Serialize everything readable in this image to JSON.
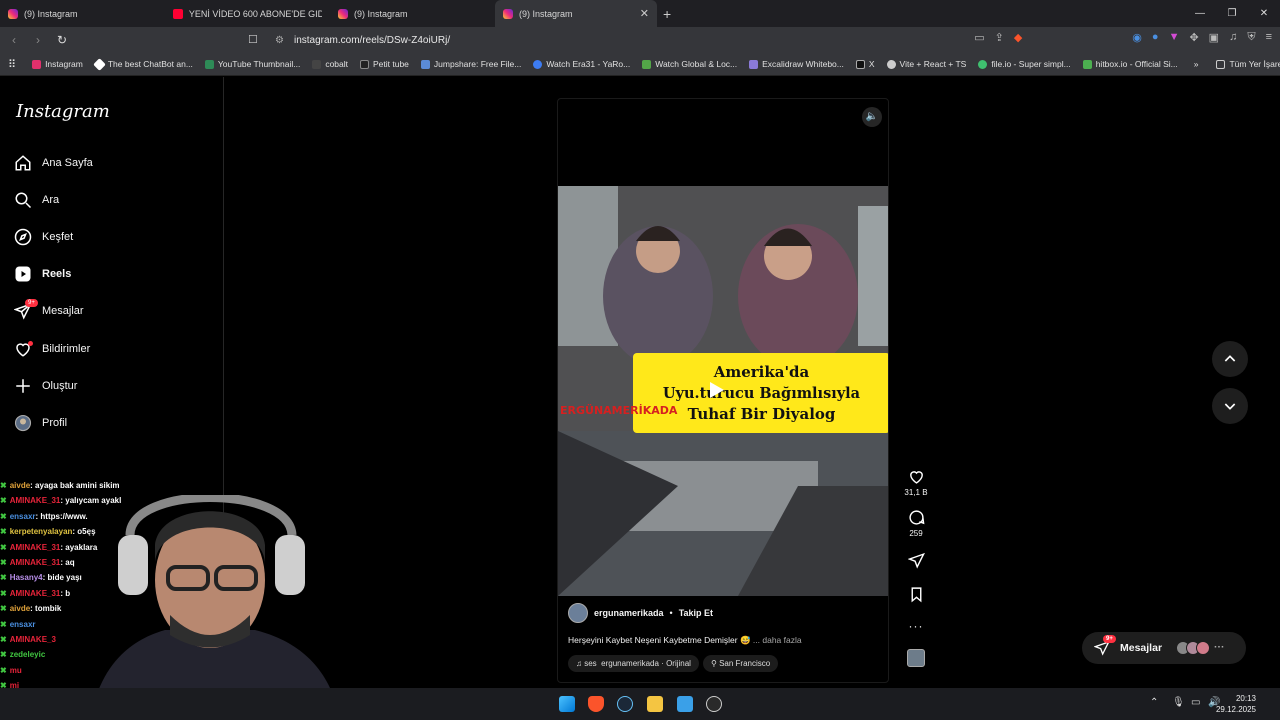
{
  "browser": {
    "tabs": [
      {
        "title": "(9) Instagram",
        "icon": "instagram-icon"
      },
      {
        "title": "YENİ VİDEO 600 ABONE'DE GIDIKLA…",
        "icon": "youtube-icon"
      },
      {
        "title": "(9) Instagram",
        "icon": "instagram-icon"
      },
      {
        "title": "(9) Instagram",
        "icon": "instagram-icon",
        "active": true
      }
    ],
    "url": "instagram.com/reels/DSw-Z4oiURj/",
    "bookmarks": [
      "Instagram",
      "The best ChatBot an...",
      "YouTube Thumbnail...",
      "cobalt",
      "Petit tube",
      "Jumpshare: Free File...",
      "Watch Era31 - YaRo...",
      "Watch Global & Loc...",
      "Excalidraw Whitebo...",
      "X",
      "Vite + React + TS",
      "file.io - Super simpl...",
      "hitbox.io - Official Si..."
    ],
    "bookmarks_more": "»",
    "all_bookmarks": "Tüm Yer İşaretleri"
  },
  "sidebar": {
    "logo": "Instagram",
    "items": [
      {
        "label": "Ana Sayfa"
      },
      {
        "label": "Ara"
      },
      {
        "label": "Keşfet"
      },
      {
        "label": "Reels"
      },
      {
        "label": "Mesajlar",
        "badge": "9+"
      },
      {
        "label": "Bildirimler"
      },
      {
        "label": "Oluştur"
      },
      {
        "label": "Profil"
      }
    ]
  },
  "chat": [
    {
      "user": "aivde",
      "color": "#e0a23a",
      "msg": ": ayaga bak amini sikim"
    },
    {
      "user": "AMINAKE_31",
      "color": "#e8243a",
      "msg": ": yalıycam ayakl"
    },
    {
      "user": "ensaxr",
      "color": "#4a8fe0",
      "msg": ": https://www."
    },
    {
      "user": "kerpetenyalayan",
      "color": "#e0c341",
      "msg": ": o5ęş"
    },
    {
      "user": "AMINAKE_31",
      "color": "#e8243a",
      "msg": ": ayaklara"
    },
    {
      "user": "AMINAKE_31",
      "color": "#e8243a",
      "msg": ": aq"
    },
    {
      "user": "Hasany4",
      "color": "#b78ee8",
      "msg": ": bide yaşı"
    },
    {
      "user": "AMINAKE_31",
      "color": "#e8243a",
      "msg": ": b"
    },
    {
      "user": "aivde",
      "color": "#e0a23a",
      "msg": ": tombik"
    },
    {
      "user": "ensaxr",
      "color": "#4a8fe0",
      "msg": ""
    },
    {
      "user": "AMINAKE_3",
      "color": "#e8243a",
      "msg": ""
    },
    {
      "user": "zedeleyic",
      "color": "#41c641",
      "msg": ""
    },
    {
      "user": "mu",
      "color": "#e8243a",
      "msg": ""
    },
    {
      "user": "mi",
      "color": "#e8243a",
      "msg": ""
    }
  ],
  "reel": {
    "banner_line1": "Amerika'da",
    "banner_line2": "Uyu.turucu Bağımlısıyla",
    "banner_line3": "Tuhaf Bir Diyalog",
    "watermark": "ERGÜNAMERİKADA",
    "username": "ergunamerikada",
    "separator": "•",
    "follow": "Takip Et",
    "caption": "Herşeyini Kaybet Neşeni Kaybetme Demişler 😅",
    "more": "... daha fazla",
    "audio_prefix": "ses",
    "audio": "ergunamerikada · Orijinal",
    "location": "San Francisco"
  },
  "actions": {
    "likes": "31,1 B",
    "comments": "259"
  },
  "messages_pill": {
    "label": "Mesajlar",
    "badge": "9+"
  },
  "taskbar": {
    "time": "20:13",
    "date": "29.12.2025"
  }
}
